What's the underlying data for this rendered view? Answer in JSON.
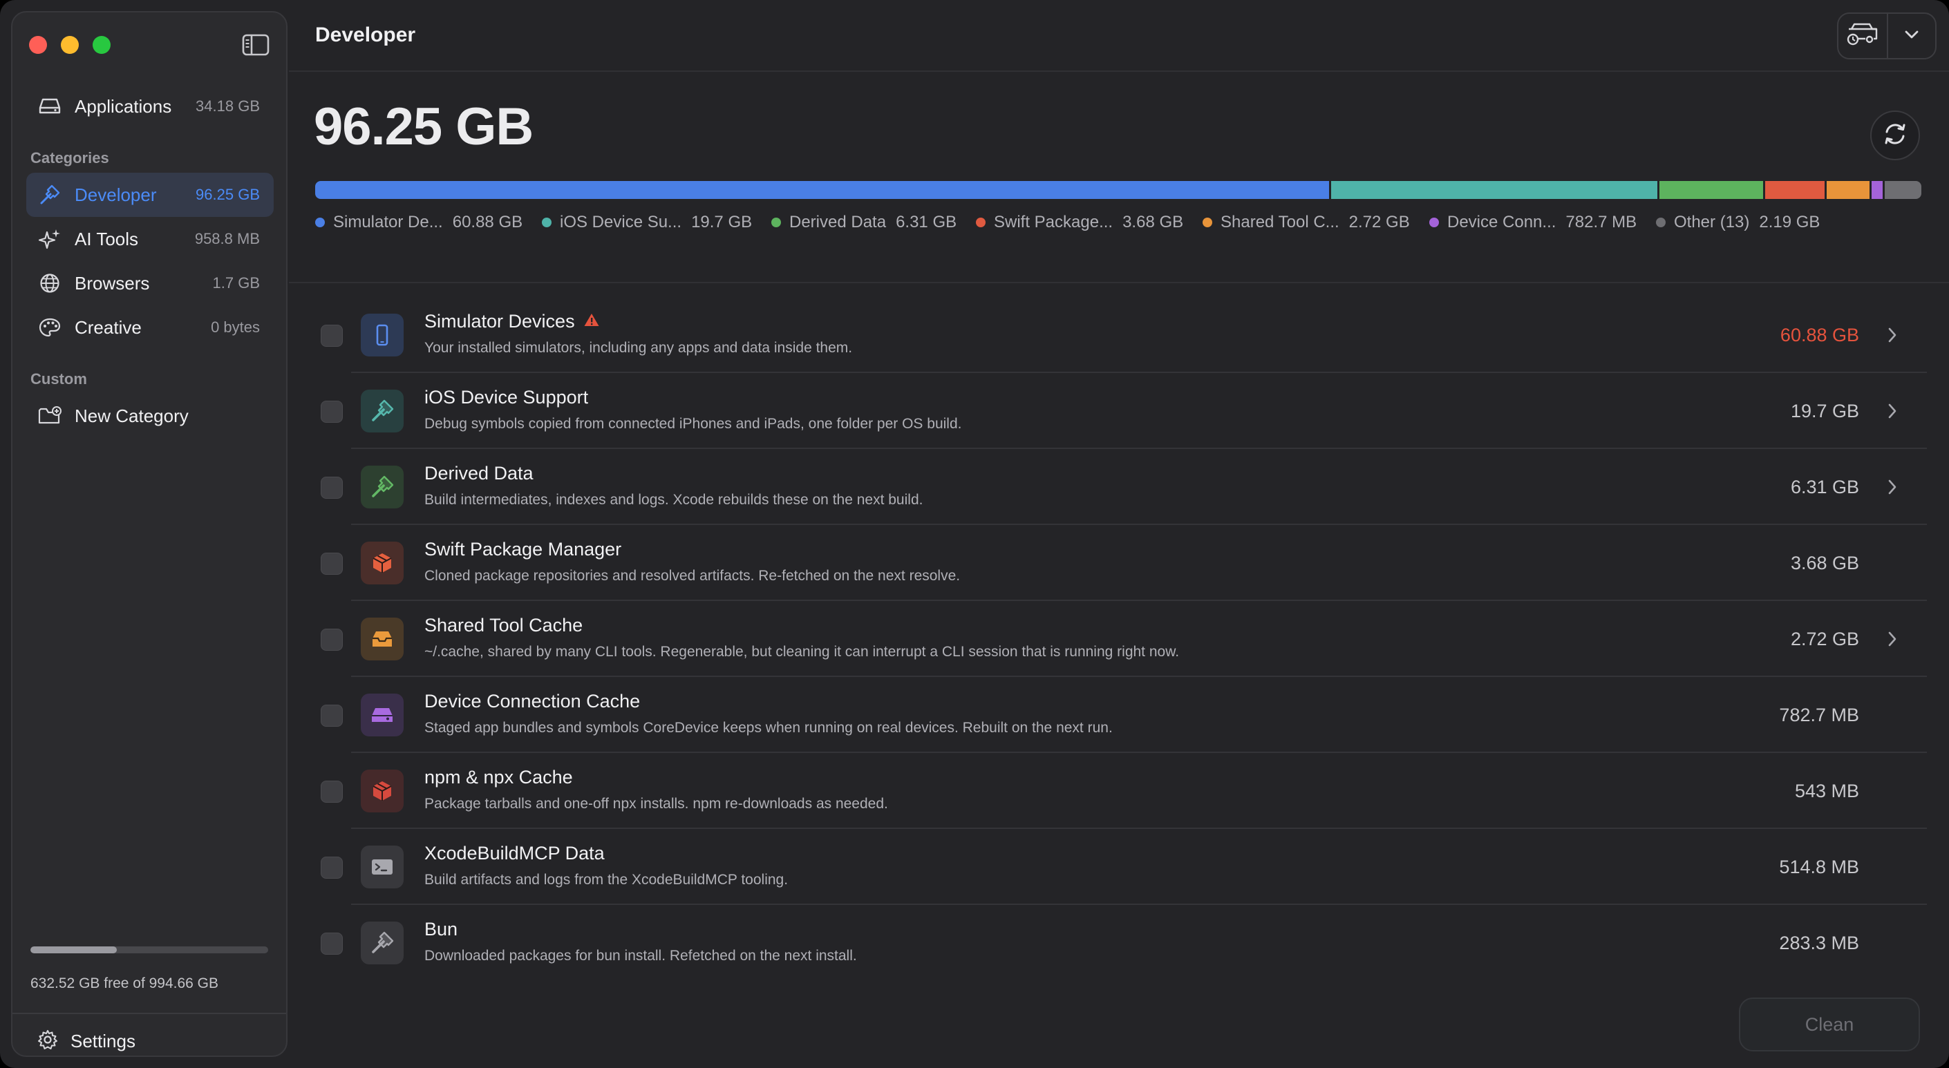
{
  "sidebar": {
    "apps": {
      "label": "Applications",
      "size": "34.18 GB"
    },
    "categories_label": "Categories",
    "categories": [
      {
        "label": "Developer",
        "size": "96.25 GB",
        "icon": "hammer-icon",
        "selected": true
      },
      {
        "label": "AI Tools",
        "size": "958.8 MB",
        "icon": "sparkles-icon"
      },
      {
        "label": "Browsers",
        "size": "1.7 GB",
        "icon": "globe-icon"
      },
      {
        "label": "Creative",
        "size": "0 bytes",
        "icon": "palette-icon"
      }
    ],
    "custom_label": "Custom",
    "new_category": "New Category",
    "disk": {
      "text": "632.52 GB free of 994.66 GB",
      "used_fraction": 0.364
    },
    "settings_label": "Settings"
  },
  "header": {
    "title": "Developer"
  },
  "summary": {
    "total": "96.25 GB",
    "breakdown": [
      {
        "name": "Simulator De...",
        "value": "60.88 GB",
        "gb": 60.88,
        "color": "#4a7fe5"
      },
      {
        "name": "iOS Device Su...",
        "value": "19.7 GB",
        "gb": 19.7,
        "color": "#4fb3a9"
      },
      {
        "name": "Derived Data",
        "value": "6.31 GB",
        "gb": 6.31,
        "color": "#5db35e"
      },
      {
        "name": "Swift Package...",
        "value": "3.68 GB",
        "gb": 3.68,
        "color": "#e05a40"
      },
      {
        "name": "Shared Tool C...",
        "value": "2.72 GB",
        "gb": 2.72,
        "color": "#e8943a"
      },
      {
        "name": "Device Conn...",
        "value": "782.7 MB",
        "gb": 0.78,
        "color": "#a463d9"
      },
      {
        "name": "Other (13)",
        "value": "2.19 GB",
        "gb": 2.19,
        "color": "#6e6e72"
      }
    ]
  },
  "items": [
    {
      "title": "Simulator Devices",
      "desc": "Your installed simulators, including any apps and data inside them.",
      "size": "60.88 GB",
      "warn": true,
      "chevron": true,
      "icon": "iphone-icon",
      "icon_bg": "#2d3a55",
      "icon_color": "#5b8ef0"
    },
    {
      "title": "iOS Device Support",
      "desc": "Debug symbols copied from connected iPhones and iPads, one folder per OS build.",
      "size": "19.7 GB",
      "chevron": true,
      "icon": "hammer-icon",
      "icon_bg": "#284040",
      "icon_color": "#56b8ad"
    },
    {
      "title": "Derived Data",
      "desc": "Build intermediates, indexes and logs. Xcode rebuilds these on the next build.",
      "size": "6.31 GB",
      "chevron": true,
      "icon": "hammer-icon",
      "icon_bg": "#2d4030",
      "icon_color": "#63b865"
    },
    {
      "title": "Swift Package Manager",
      "desc": "Cloned package repositories and resolved artifacts. Re-fetched on the next  resolve.",
      "size": "3.68 GB",
      "chevron": false,
      "icon": "package-icon",
      "icon_bg": "#4a2e2a",
      "icon_color": "#e5603f"
    },
    {
      "title": "Shared Tool Cache",
      "desc": "~/.cache, shared by many CLI tools. Regenerable, but cleaning it can interrupt a CLI session that is running right now.",
      "size": "2.72 GB",
      "chevron": true,
      "icon": "tray-icon",
      "icon_bg": "#4a3a28",
      "icon_color": "#eb9a3c"
    },
    {
      "title": "Device Connection Cache",
      "desc": "Staged app bundles and symbols CoreDevice keeps when running on real  devices. Rebuilt on the next run.",
      "size": "782.7 MB",
      "chevron": false,
      "icon": "drive-icon",
      "icon_bg": "#3a2f4a",
      "icon_color": "#a86ae0"
    },
    {
      "title": "npm & npx Cache",
      "desc": "Package tarballs and one-off npx installs. npm re-downloads as needed.",
      "size": "543 MB",
      "chevron": false,
      "icon": "package-icon",
      "icon_bg": "#45292a",
      "icon_color": "#d64a3e"
    },
    {
      "title": "XcodeBuildMCP Data",
      "desc": "Build artifacts and logs from the XcodeBuildMCP tooling.",
      "size": "514.8 MB",
      "chevron": false,
      "icon": "terminal-icon",
      "icon_bg": "#38383c",
      "icon_color": "#a8a8ae"
    },
    {
      "title": "Bun",
      "desc": "Downloaded packages for bun install. Refetched on the next install.",
      "size": "283.3 MB",
      "chevron": false,
      "icon": "hammer-icon",
      "icon_bg": "#38383c",
      "icon_color": "#a8a8ae"
    }
  ],
  "actions": {
    "clean_label": "Clean"
  }
}
